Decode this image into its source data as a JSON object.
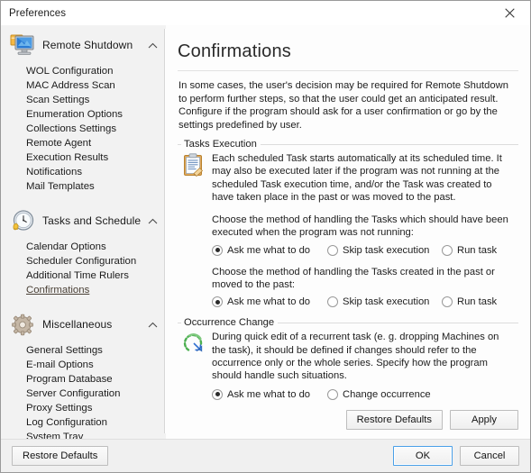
{
  "window": {
    "title": "Preferences",
    "close_icon": "close-icon"
  },
  "sidebar": {
    "groups": [
      {
        "title": "Remote Shutdown",
        "icon": "monitor-icon",
        "chevron": "chevron-up-icon",
        "items": [
          {
            "label": "WOL Configuration",
            "selected": false
          },
          {
            "label": "MAC Address Scan",
            "selected": false
          },
          {
            "label": "Scan Settings",
            "selected": false
          },
          {
            "label": "Enumeration Options",
            "selected": false
          },
          {
            "label": "Collections Settings",
            "selected": false
          },
          {
            "label": "Remote Agent",
            "selected": false
          },
          {
            "label": "Execution Results",
            "selected": false
          },
          {
            "label": "Notifications",
            "selected": false
          },
          {
            "label": "Mail Templates",
            "selected": false
          }
        ]
      },
      {
        "title": "Tasks and Schedule",
        "icon": "clock-alarm-icon",
        "chevron": "chevron-up-icon",
        "items": [
          {
            "label": "Calendar Options",
            "selected": false
          },
          {
            "label": "Scheduler Configuration",
            "selected": false
          },
          {
            "label": "Additional Time Rulers",
            "selected": false
          },
          {
            "label": "Confirmations",
            "selected": true
          }
        ]
      },
      {
        "title": "Miscellaneous",
        "icon": "gear-icon",
        "chevron": "chevron-up-icon",
        "items": [
          {
            "label": "General Settings",
            "selected": false
          },
          {
            "label": "E-mail Options",
            "selected": false
          },
          {
            "label": "Program Database",
            "selected": false
          },
          {
            "label": "Server Configuration",
            "selected": false
          },
          {
            "label": "Proxy Settings",
            "selected": false
          },
          {
            "label": "Log Configuration",
            "selected": false
          },
          {
            "label": "System Tray",
            "selected": false
          }
        ]
      }
    ]
  },
  "content": {
    "title": "Confirmations",
    "intro": "In some cases, the user's decision may be required for Remote Shutdown to perform further steps, so that the user could get an anticipated result. Configure if the program should ask for a user confirmation or go by the settings predefined by user.",
    "tasks_execution": {
      "legend": "Tasks Execution",
      "icon": "clipboard-icon",
      "description": "Each scheduled Task starts automatically at its scheduled time. It may also be executed later if the program was not running at the scheduled Task execution time, and/or the Task was created to have taken place in the past or was moved to the past.",
      "prompt_1": "Choose the method of handling the Tasks which should have been executed when the program was not running:",
      "options_1": [
        {
          "label": "Ask me what to do",
          "selected": true
        },
        {
          "label": "Skip task execution",
          "selected": false
        },
        {
          "label": "Run task",
          "selected": false
        }
      ],
      "prompt_2": "Choose the method of handling the Tasks created in the past or moved to the past:",
      "options_2": [
        {
          "label": "Ask me what to do",
          "selected": true
        },
        {
          "label": "Skip task execution",
          "selected": false
        },
        {
          "label": "Run task",
          "selected": false
        }
      ]
    },
    "occurrence_change": {
      "legend": "Occurrence Change",
      "icon": "recurrence-icon",
      "description": "During quick edit of a recurrent task (e. g. dropping Machines on the task), it should be defined if changes should refer to the occurrence only or the whole series. Specify how the program should handle such situations.",
      "options": [
        {
          "label": "Ask me what to do",
          "selected": true
        },
        {
          "label": "Change occurrence",
          "selected": false
        }
      ]
    },
    "restore_defaults_label": "Restore Defaults",
    "apply_label": "Apply"
  },
  "footer": {
    "restore_defaults_label": "Restore Defaults",
    "ok_label": "OK",
    "cancel_label": "Cancel"
  }
}
